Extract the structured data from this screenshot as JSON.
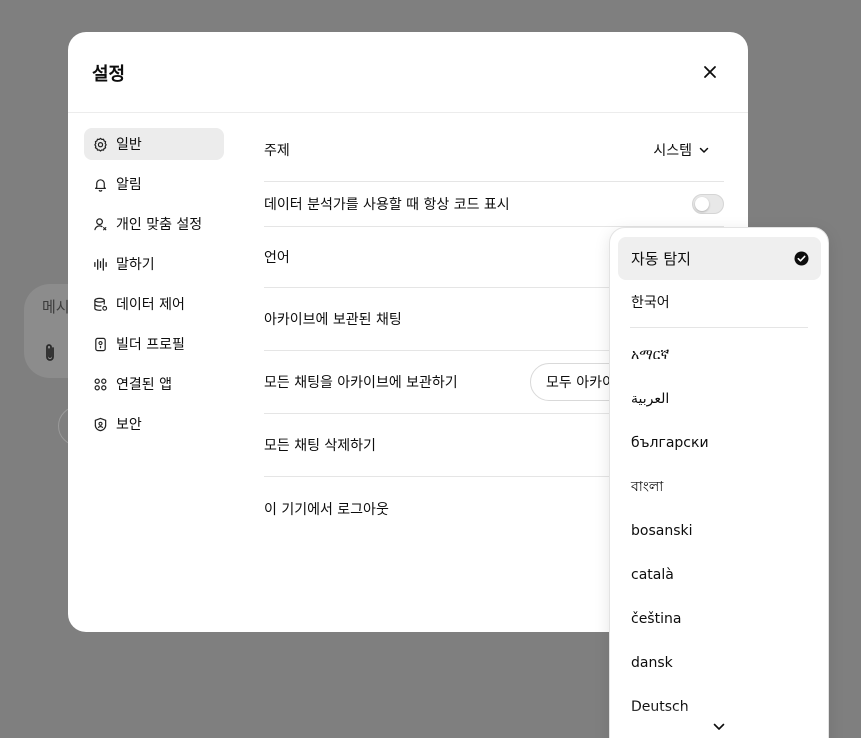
{
  "background": {
    "composer_placeholder": "메시",
    "overlay_color": "#7f7f7f"
  },
  "modal": {
    "title": "설정",
    "close_icon": "close-icon"
  },
  "sidebar": {
    "items": [
      {
        "label": "일반",
        "icon": "gear-icon",
        "active": true
      },
      {
        "label": "알림",
        "icon": "bell-icon"
      },
      {
        "label": "개인 맞춤 설정",
        "icon": "person-icon"
      },
      {
        "label": "말하기",
        "icon": "waveform-icon"
      },
      {
        "label": "데이터 제어",
        "icon": "database-icon"
      },
      {
        "label": "빌더 프로필",
        "icon": "id-badge-icon"
      },
      {
        "label": "연결된 앱",
        "icon": "apps-grid-icon"
      },
      {
        "label": "보안",
        "icon": "shield-icon"
      }
    ]
  },
  "general": {
    "theme_label": "주제",
    "theme_value": "시스템",
    "code_label": "데이터 분석가를 사용할 때 항상 코드 표시",
    "code_toggle_on": false,
    "language_label": "언어",
    "archived_label": "아카이브에 보관된 채팅",
    "archive_all_label": "모든 채팅을 아카이브에 보관하기",
    "archive_all_button": "모두 아카이브",
    "delete_all_label": "모든 채팅 삭제하기",
    "logout_label": "이 기기에서 로그아웃"
  },
  "language_menu": {
    "selected": "자동 탐지",
    "pinned": [
      "자동 탐지",
      "한국어"
    ],
    "options": [
      "አማርኛ",
      "العربية",
      "български",
      "বাংলা",
      "bosanski",
      "català",
      "čeština",
      "dansk",
      "Deutsch"
    ]
  }
}
